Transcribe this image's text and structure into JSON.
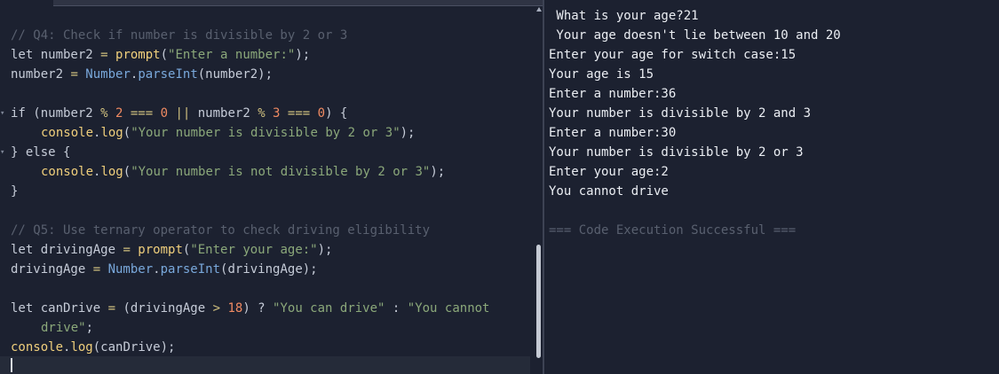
{
  "editor": {
    "code_lines": [
      {
        "parts": [
          {
            "t": "// Q4: Check if number is divisible by 2 or 3",
            "c": "cmt"
          }
        ]
      },
      {
        "parts": [
          {
            "t": "let ",
            "c": "kw"
          },
          {
            "t": "number2 ",
            "c": "kw"
          },
          {
            "t": "= ",
            "c": "op"
          },
          {
            "t": "prompt",
            "c": "fn"
          },
          {
            "t": "(",
            "c": "kw"
          },
          {
            "t": "\"Enter a number:\"",
            "c": "str"
          },
          {
            "t": ");",
            "c": "kw"
          }
        ]
      },
      {
        "parts": [
          {
            "t": "number2 ",
            "c": "kw"
          },
          {
            "t": "= ",
            "c": "op"
          },
          {
            "t": "Number",
            "c": "cls"
          },
          {
            "t": ".",
            "c": "kw"
          },
          {
            "t": "parseInt",
            "c": "cls"
          },
          {
            "t": "(number2);",
            "c": "kw"
          }
        ]
      },
      {
        "parts": []
      },
      {
        "fold": true,
        "parts": [
          {
            "t": "if ",
            "c": "kw"
          },
          {
            "t": "(number2 ",
            "c": "kw"
          },
          {
            "t": "% ",
            "c": "op"
          },
          {
            "t": "2 ",
            "c": "num"
          },
          {
            "t": "=== ",
            "c": "op"
          },
          {
            "t": "0 ",
            "c": "num"
          },
          {
            "t": "|| ",
            "c": "op"
          },
          {
            "t": "number2 ",
            "c": "kw"
          },
          {
            "t": "% ",
            "c": "op"
          },
          {
            "t": "3 ",
            "c": "num"
          },
          {
            "t": "=== ",
            "c": "op"
          },
          {
            "t": "0",
            "c": "num"
          },
          {
            "t": ") {",
            "c": "kw"
          }
        ]
      },
      {
        "indent": true,
        "parts": [
          {
            "t": "console",
            "c": "fn"
          },
          {
            "t": ".",
            "c": "kw"
          },
          {
            "t": "log",
            "c": "fn"
          },
          {
            "t": "(",
            "c": "kw"
          },
          {
            "t": "\"Your number is divisible by 2 or 3\"",
            "c": "str"
          },
          {
            "t": ");",
            "c": "kw"
          }
        ]
      },
      {
        "fold": true,
        "parts": [
          {
            "t": "} else {",
            "c": "kw"
          }
        ]
      },
      {
        "indent": true,
        "parts": [
          {
            "t": "console",
            "c": "fn"
          },
          {
            "t": ".",
            "c": "kw"
          },
          {
            "t": "log",
            "c": "fn"
          },
          {
            "t": "(",
            "c": "kw"
          },
          {
            "t": "\"Your number is not divisible by 2 or 3\"",
            "c": "str"
          },
          {
            "t": ");",
            "c": "kw"
          }
        ]
      },
      {
        "parts": [
          {
            "t": "}",
            "c": "kw"
          }
        ]
      },
      {
        "parts": []
      },
      {
        "parts": [
          {
            "t": "// Q5: Use ternary operator to check driving eligibility",
            "c": "cmt"
          }
        ]
      },
      {
        "parts": [
          {
            "t": "let ",
            "c": "kw"
          },
          {
            "t": "drivingAge ",
            "c": "kw"
          },
          {
            "t": "= ",
            "c": "op"
          },
          {
            "t": "prompt",
            "c": "fn"
          },
          {
            "t": "(",
            "c": "kw"
          },
          {
            "t": "\"Enter your age:\"",
            "c": "str"
          },
          {
            "t": ");",
            "c": "kw"
          }
        ]
      },
      {
        "parts": [
          {
            "t": "drivingAge ",
            "c": "kw"
          },
          {
            "t": "= ",
            "c": "op"
          },
          {
            "t": "Number",
            "c": "cls"
          },
          {
            "t": ".",
            "c": "kw"
          },
          {
            "t": "parseInt",
            "c": "cls"
          },
          {
            "t": "(drivingAge);",
            "c": "kw"
          }
        ]
      },
      {
        "parts": []
      },
      {
        "parts": [
          {
            "t": "let ",
            "c": "kw"
          },
          {
            "t": "canDrive ",
            "c": "kw"
          },
          {
            "t": "= ",
            "c": "op"
          },
          {
            "t": "(drivingAge ",
            "c": "kw"
          },
          {
            "t": "> ",
            "c": "op"
          },
          {
            "t": "18",
            "c": "num"
          },
          {
            "t": ") ? ",
            "c": "kw"
          },
          {
            "t": "\"You can drive\"",
            "c": "str"
          },
          {
            "t": " : ",
            "c": "kw"
          },
          {
            "t": "\"You cannot",
            "c": "str"
          }
        ]
      },
      {
        "indent": true,
        "parts": [
          {
            "t": "drive\"",
            "c": "str"
          },
          {
            "t": ";",
            "c": "kw"
          }
        ]
      },
      {
        "parts": [
          {
            "t": "console",
            "c": "fn"
          },
          {
            "t": ".",
            "c": "kw"
          },
          {
            "t": "log",
            "c": "fn"
          },
          {
            "t": "(canDrive);",
            "c": "kw"
          }
        ]
      }
    ]
  },
  "output": {
    "lines": [
      " What is your age?21",
      " Your age doesn't lie between 10 and 20",
      "Enter your age for switch case:15",
      "Your age is 15",
      "Enter a number:36",
      "Your number is divisible by 2 and 3",
      "Enter a number:30",
      "Your number is divisible by 2 or 3",
      "Enter your age:2",
      "You cannot drive"
    ],
    "status": "=== Code Execution Successful ==="
  },
  "icons": {
    "fold": "fold-arrow-icon",
    "scroll_up": "scroll-up-arrow-icon"
  }
}
